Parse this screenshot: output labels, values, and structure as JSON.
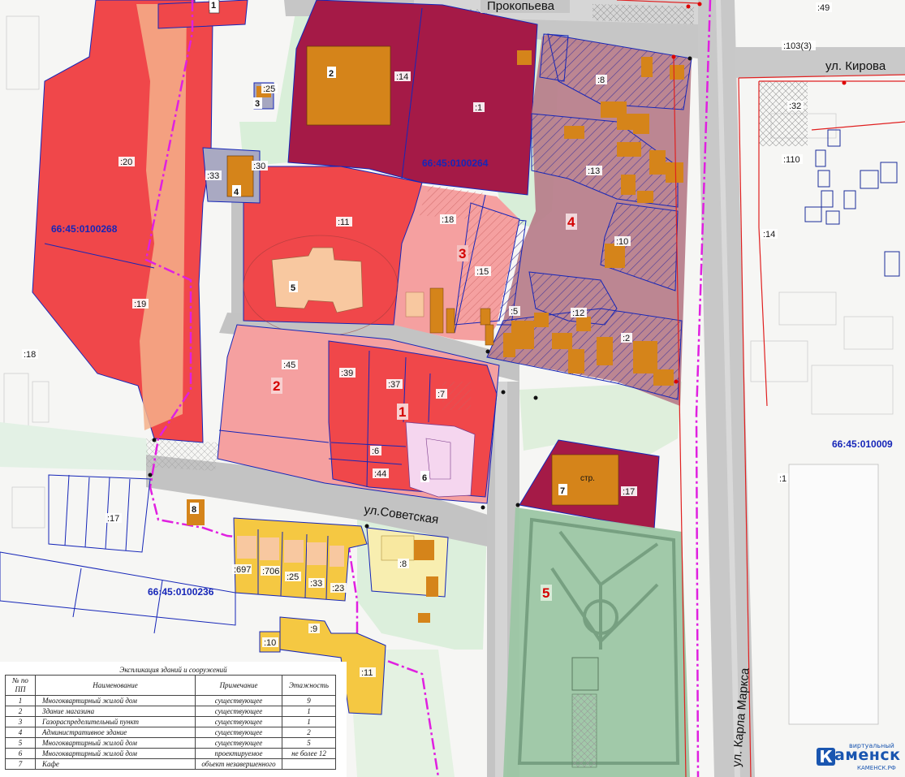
{
  "streets": {
    "prokopieva": "Прокопьева",
    "kirova": "ул. Кирова",
    "sovetskaya": "ул.Советская",
    "karla_marksa": "ул. Карла Маркса"
  },
  "cadastral_blocks": {
    "b264": "66:45:0100264",
    "b268": "66:45:0100268",
    "b236": "66:45:0100236",
    "b090": "66:45:010009"
  },
  "zones": [
    "1",
    "2",
    "3",
    "4",
    "5"
  ],
  "buildings": [
    "1",
    "2",
    "3",
    "4",
    "5",
    "6",
    "7",
    "8"
  ],
  "building_labels": {
    "stp": "стр."
  },
  "parcels": {
    "p14": ":14",
    "p1": ":1",
    "p25": ":25",
    "p30": ":30",
    "p33": ":33",
    "p20": ":20",
    "p19": ":19",
    "p18w": ":18",
    "p11": ":11",
    "p18": ":18",
    "p15": ":15",
    "p5": ":5",
    "p8": ":8",
    "p13": ":13",
    "p10": ":10",
    "p12": ":12",
    "p2": ":2",
    "p45": ":45",
    "p39": ":39",
    "p37": ":37",
    "p7": ":7",
    "p6": ":6",
    "p44": ":44",
    "p17": ":17",
    "p17w": ":17",
    "p8b": ":8",
    "p697": ":697",
    "p706": ":706",
    "p25b": ":25",
    "p33b": ":33",
    "p23": ":23",
    "p9": ":9",
    "p10b": ":10",
    "p11b": ":11",
    "p32": ":32",
    "p110": ":110",
    "p14e": ":14",
    "p49": ":49",
    "p103": ":103(3)",
    "p1e": ":1"
  },
  "legend": {
    "title": "Экспликация зданий и сооружений",
    "headers": [
      "№ по ПП",
      "Наименование",
      "Примечание",
      "Этажность"
    ],
    "rows": [
      [
        "1",
        "Многоквартирный жилой дом",
        "существующее",
        "9"
      ],
      [
        "2",
        "Здание магазина",
        "существующее",
        "1"
      ],
      [
        "3",
        "Газораспределительный пункт",
        "существующее",
        "1"
      ],
      [
        "4",
        "Административное здание",
        "существующее",
        "2"
      ],
      [
        "5",
        "Многоквартирный жилой дом",
        "существующее",
        "5"
      ],
      [
        "6",
        "Многоквартирный жилой дом",
        "проектируемое",
        "не более 12"
      ],
      [
        "7",
        "Кафе",
        "объект незавершенного",
        ""
      ]
    ]
  },
  "logo": {
    "small": "виртуальный",
    "big": "аменск",
    "letter": "К",
    "url": "КАМЕНСК.РФ"
  },
  "colors": {
    "zone_red": "#f0474a",
    "zone_pink": "#f5a0a0",
    "zone_maroon": "#a51a47",
    "zone_purple": "#b8808c",
    "zone_green": "#9cc6a4",
    "building_orange": "#d5841a",
    "building_yellow": "#f5c842",
    "cadastral_blue": "#1626b8",
    "boundary_magenta": "#e020e0"
  }
}
